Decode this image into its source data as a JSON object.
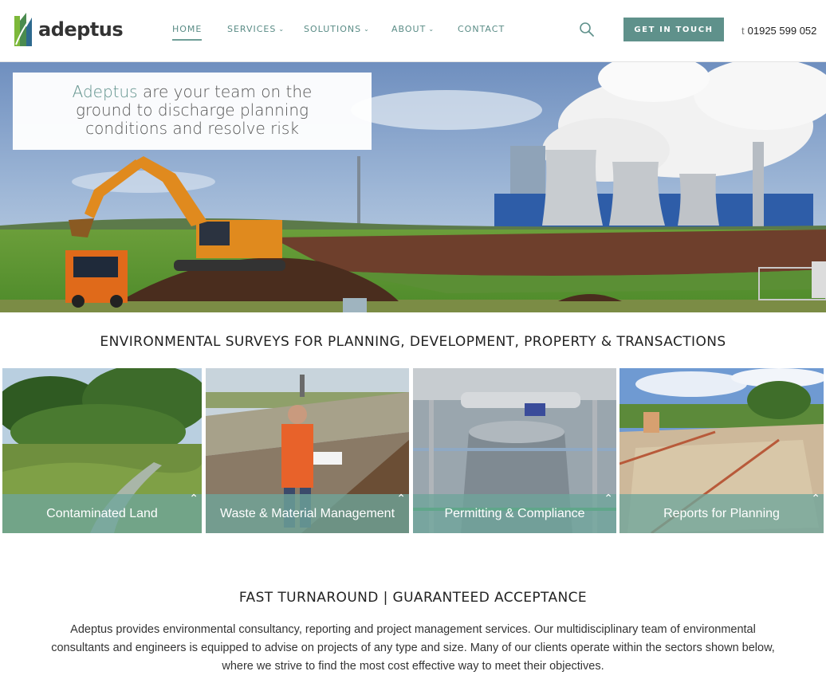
{
  "header": {
    "logo_text": "adeptus",
    "nav": [
      {
        "label": "HOME",
        "active": true,
        "has_dropdown": false
      },
      {
        "label": "SERVICES",
        "active": false,
        "has_dropdown": true
      },
      {
        "label": "SOLUTIONS",
        "active": false,
        "has_dropdown": true
      },
      {
        "label": "ABOUT",
        "active": false,
        "has_dropdown": true
      },
      {
        "label": "CONTACT",
        "active": false,
        "has_dropdown": false
      }
    ],
    "cta_label": "GET IN TOUCH",
    "phone_prefix": "t",
    "phone": "01925 599 052"
  },
  "hero": {
    "brand": "Adeptus",
    "line1_rest": " are your team on the",
    "line2": "ground to discharge planning",
    "line3": "conditions and resolve risk"
  },
  "section_services": {
    "title": "ENVIRONMENTAL SURVEYS FOR PLANNING, DEVELOPMENT, PROPERTY & TRANSACTIONS",
    "cards": [
      {
        "label": "Contaminated Land"
      },
      {
        "label": "Waste & Material Management"
      },
      {
        "label": "Permitting & Compliance"
      },
      {
        "label": "Reports for Planning"
      }
    ]
  },
  "section_intro": {
    "title": "FAST TURNAROUND | GUARANTEED ACCEPTANCE",
    "body": "Adeptus provides environmental consultancy, reporting and project management services. Our multidisciplinary team of environmental consultants and engineers is equipped to advise on projects of any type and size. Many of our clients operate within the sectors shown below, where we strive to find the most cost effective way to meet their objectives."
  },
  "colors": {
    "accent": "#5f918b",
    "nav_text": "#5a8c86",
    "card_overlay": "#6ea59b"
  },
  "icons": {
    "search": "search-icon",
    "card_expand": "chevron-up-icon",
    "nav_dropdown": "chevron-down-icon"
  }
}
